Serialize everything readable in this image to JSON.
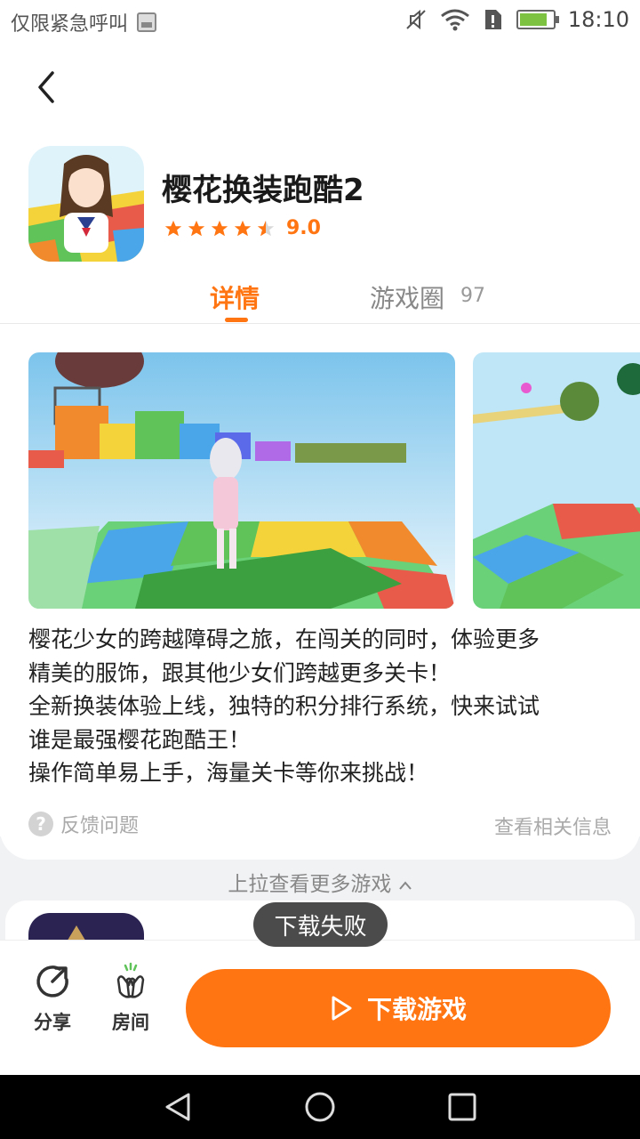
{
  "status_bar": {
    "left_text": "仅限紧急呼叫",
    "time": "18:10",
    "battery_level": 0.85
  },
  "app": {
    "title": "樱花换装跑酷2",
    "rating_value": "9.0",
    "rating_stars": 4.5
  },
  "tabs": {
    "detail_label": "详情",
    "circle_label": "游戏圈",
    "circle_count": "97"
  },
  "description": {
    "lines": [
      "樱花少女的跨越障碍之旅，在闯关的同时，体验更多",
      "精美的服饰，跟其他少女们跨越更多关卡！",
      "全新换装体验上线，独特的积分排行系统，快来试试",
      "谁是最强樱花跑酷王！",
      "操作简单易上手，海量关卡等你来挑战！"
    ]
  },
  "links": {
    "feedback": "反馈问题",
    "related": "查看相关信息",
    "pull_more": "上拉查看更多游戏"
  },
  "toast": "下载失败",
  "actions": {
    "share": "分享",
    "room": "房间",
    "download": "下载游戏"
  },
  "colors": {
    "accent": "#ff7512",
    "icons": [
      "chevron-left-icon",
      "star-icon",
      "share-icon",
      "clap-icon",
      "play-icon",
      "question-icon",
      "chevron-up-icon"
    ]
  }
}
